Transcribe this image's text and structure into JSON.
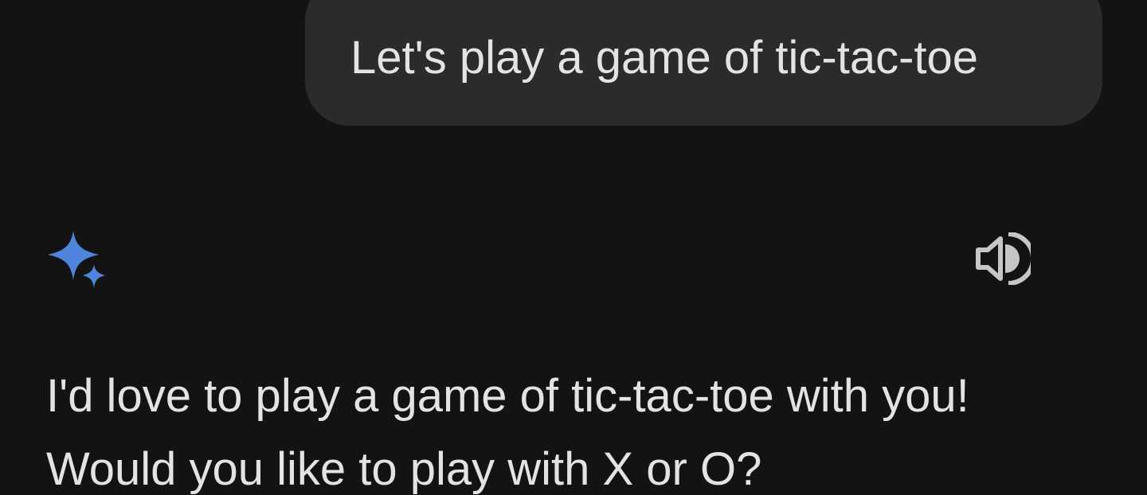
{
  "user_message": {
    "text": "Let's play a game of tic-tac-toe"
  },
  "assistant": {
    "icon": "sparkle-icon",
    "icon_color": "#4e86dd",
    "speaker_icon": "speaker-icon",
    "response_lines": [
      "I'd love to play a game of tic-tac-toe with you!",
      "Would you like to play with X or O?"
    ]
  },
  "colors": {
    "background": "#131314",
    "bubble": "#2a2b2d",
    "text": "#e3e3e3"
  }
}
